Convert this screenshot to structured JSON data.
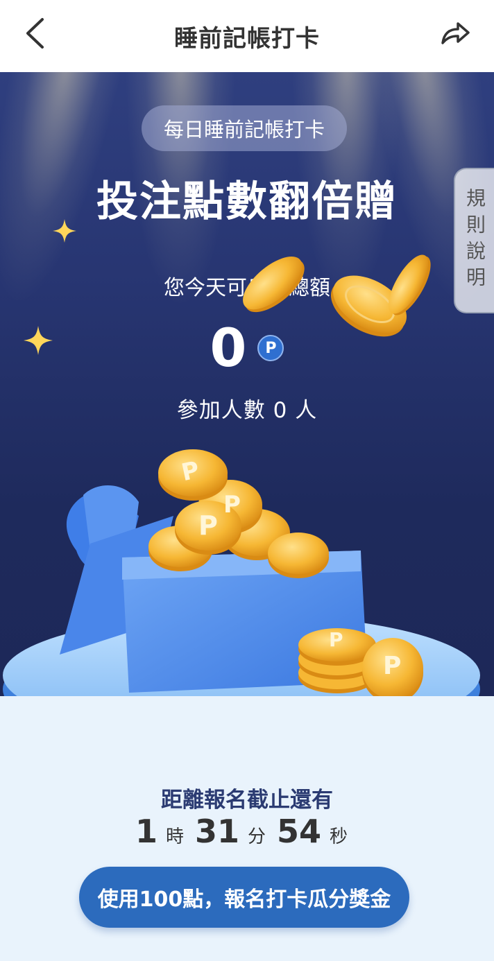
{
  "header": {
    "title": "睡前記帳打卡",
    "back_icon": "chevron-left-icon",
    "share_icon": "share-arrow-icon"
  },
  "hero": {
    "badge": "每日睡前記帳打卡",
    "headline": "投注點數翻倍贈",
    "subtitle": "您今天可瓜分總額",
    "amount": "0",
    "point_symbol": "P",
    "participants": "參加人數 0 人",
    "coin_symbol": "P"
  },
  "rules_tab": {
    "label": "規則說明"
  },
  "countdown": {
    "label": "距離報名截止還有",
    "hours": "1",
    "hours_unit": "時",
    "minutes": "31",
    "minutes_unit": "分",
    "seconds": "54",
    "seconds_unit": "秒"
  },
  "cta": {
    "label": "使用100點，報名打卡瓜分獎金"
  },
  "colors": {
    "hero_bg": "#253370",
    "cta": "#2c6bbd",
    "bottom_bg": "#e9f3fc",
    "coin": "#f2b233"
  }
}
